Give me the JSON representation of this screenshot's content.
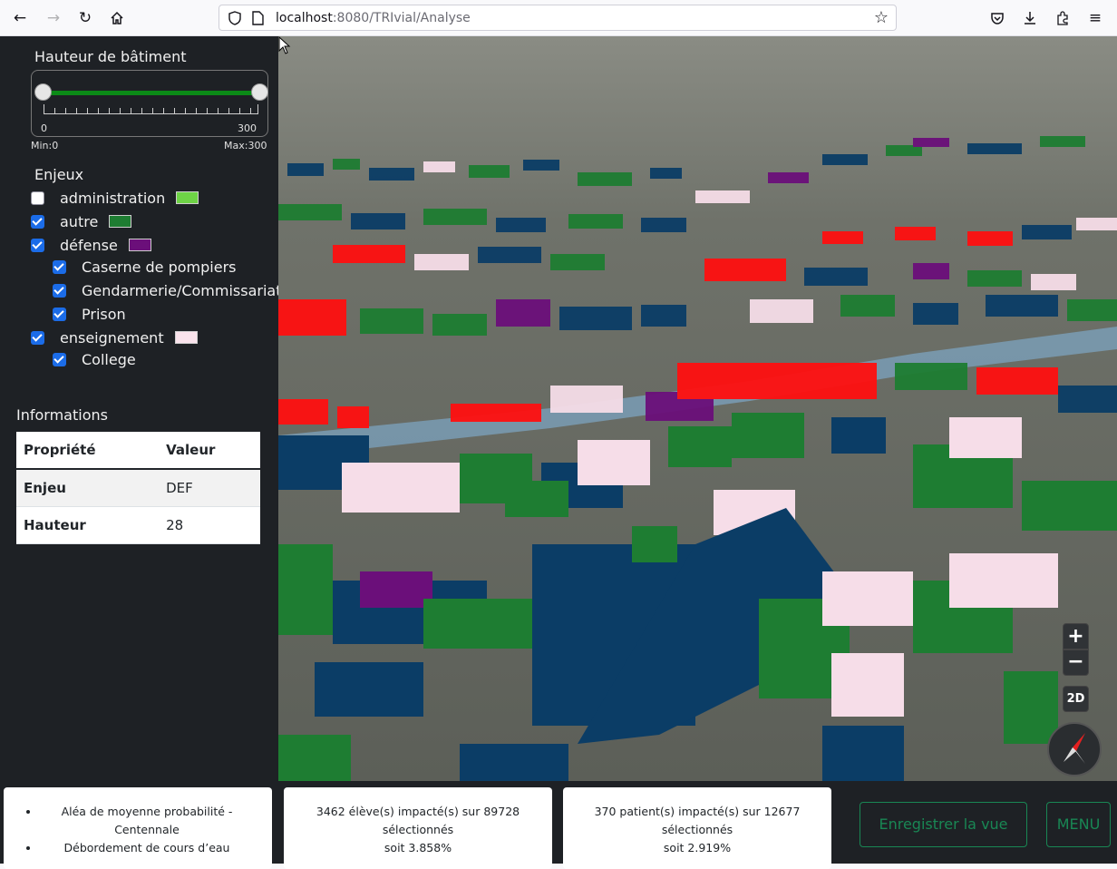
{
  "browser": {
    "url_host": "localhost",
    "url_rest": ":8080/TRIvial/Analyse"
  },
  "slider": {
    "title": "Hauteur de bâtiment",
    "tick_min": "0",
    "tick_max": "300",
    "min_label": "Min:0",
    "max_label": "Max:300",
    "min_value": 0,
    "max_value": 300
  },
  "enjeux": {
    "title": "Enjeux",
    "items": [
      {
        "label": "administration",
        "checked": false,
        "color": "#6ed346"
      },
      {
        "label": "autre",
        "checked": true,
        "color": "#1e7d32"
      },
      {
        "label": "défense",
        "checked": true,
        "color": "#6b0f7a"
      },
      {
        "label": "Caserne de pompiers",
        "checked": true
      },
      {
        "label": "Gendarmerie/Commissariat",
        "checked": true
      },
      {
        "label": "Prison",
        "checked": true
      },
      {
        "label": "enseignement",
        "checked": true,
        "color": "#fae3ec"
      },
      {
        "label": "College",
        "checked": true
      }
    ]
  },
  "info": {
    "title": "Informations",
    "headers": [
      "Propriété",
      "Valeur"
    ],
    "rows": [
      {
        "key": "Enjeu",
        "value": "DEF"
      },
      {
        "key": "Hauteur",
        "value": "28"
      }
    ]
  },
  "map_controls": {
    "zoom_in": "+",
    "zoom_out": "−",
    "mode": "2D"
  },
  "bottom": {
    "alea": [
      "Aléa de moyenne probabilité - Centennale",
      "Débordement de cours d’eau"
    ],
    "eleves_line1": "3462 élève(s) impacté(s) sur 89728",
    "eleves_line2": "sélectionnés",
    "eleves_line3": "soit 3.858%",
    "patients_line1": "370 patient(s) impacté(s) sur 12677",
    "patients_line2": "sélectionnés",
    "patients_line3": "soit 2.919%",
    "save_button": "Enregistrer la vue",
    "menu_button": "MENU"
  },
  "colors": {
    "buildings_autre": "#1e7d32",
    "buildings_autre_navy": "#0b3d66",
    "buildings_red": "#ff1010",
    "buildings_pink": "#f6dde8",
    "buildings_purple": "#6b0f7a",
    "accent_green": "#198754"
  }
}
